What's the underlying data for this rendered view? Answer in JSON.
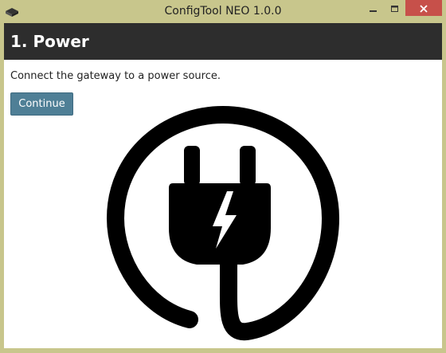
{
  "window": {
    "title": "ConfigTool NEO 1.0.0",
    "controls": [
      "minimize-icon",
      "maximize-icon",
      "close-icon"
    ]
  },
  "step": {
    "title": "1. Power",
    "instruction": "Connect the gateway to a power source.",
    "continue_label": "Continue"
  },
  "illustration": {
    "icon": "power-plug-icon"
  },
  "colors": {
    "header_bg": "#2d2d2d",
    "button_bg": "#4f7f96",
    "close_bg": "#c7504a",
    "frame": "#c8c68c"
  }
}
